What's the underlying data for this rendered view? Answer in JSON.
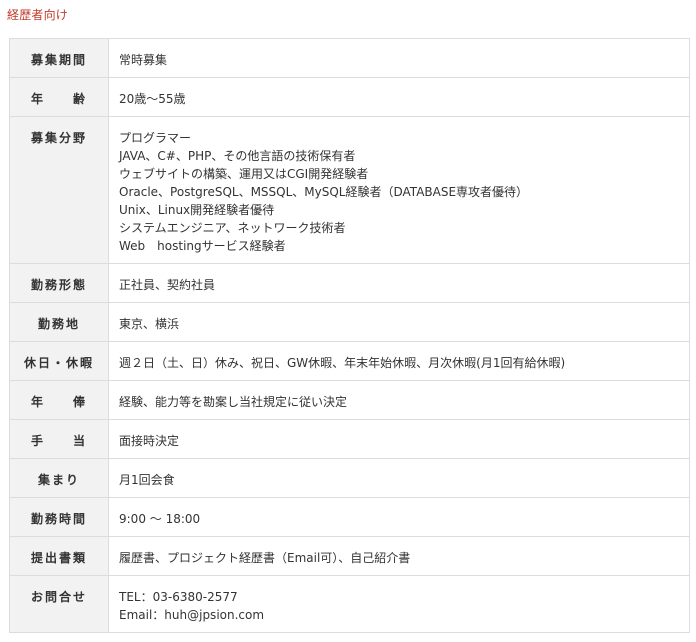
{
  "section_title": "経歴者向け",
  "rows": [
    {
      "label": "募集期間",
      "values": [
        "常時募集"
      ]
    },
    {
      "label": "年　　齢",
      "values": [
        "20歳～55歳"
      ]
    },
    {
      "label": "募集分野",
      "values": [
        "プログラマー",
        "JAVA、C#、PHP、その他言語の技術保有者",
        "ウェブサイトの構築、運用又はCGI開発経験者",
        "Oracle、PostgreSQL、MSSQL、MySQL経験者（DATABASE専攻者優待）",
        "Unix、Linux開発経験者優待",
        "システムエンジニア、ネットワーク技術者",
        "Web　hostingサービス経験者"
      ]
    },
    {
      "label": "勤務形態",
      "values": [
        "正社員、契約社員"
      ]
    },
    {
      "label": "勤務地",
      "values": [
        "東京、横浜"
      ]
    },
    {
      "label": "休日・休暇",
      "values": [
        "週２日（土、日）休み、祝日、GW休暇、年末年始休暇、月次休暇(月1回有給休暇)"
      ]
    },
    {
      "label": "年　　俸",
      "values": [
        "経験、能力等を勘案し当社規定に従い決定"
      ]
    },
    {
      "label": "手　　当",
      "values": [
        "面接時決定"
      ]
    },
    {
      "label": "集まり",
      "values": [
        "月1回会食"
      ]
    },
    {
      "label": "勤務時間",
      "values": [
        "9:00 ～ 18:00"
      ]
    },
    {
      "label": "提出書類",
      "values": [
        "履歴書、プロジェクト経歴書（Email可）、自己紹介書"
      ]
    },
    {
      "label": "お問合せ",
      "values": [
        "TEL：03-6380-2577",
        "Email：huh@jpsion.com"
      ]
    }
  ]
}
